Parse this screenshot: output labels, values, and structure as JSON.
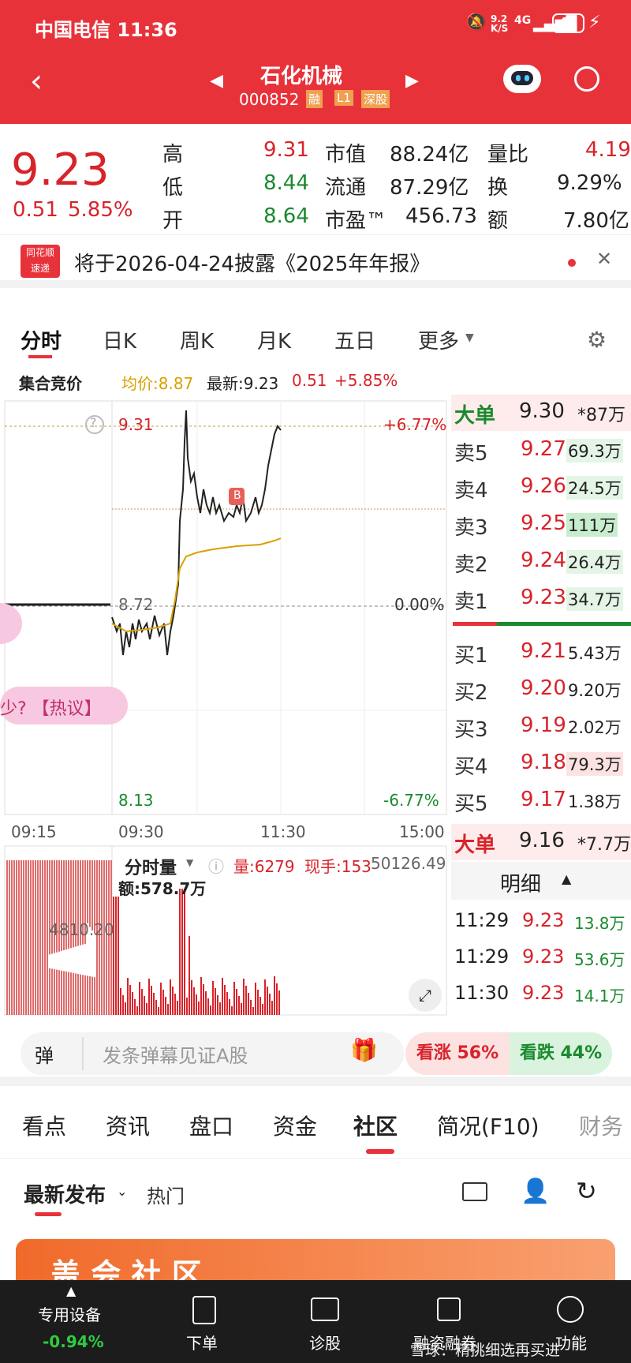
{
  "status": {
    "carrier_time": "中国电信 11:36",
    "net_speed": "9.2 K/S",
    "network": "4G",
    "battery": "43"
  },
  "header": {
    "title": "石化机械",
    "code": "000852",
    "badges": [
      "融",
      "L1",
      "深股"
    ]
  },
  "quote": {
    "price": "9.23",
    "change": "0.51",
    "change_pct": "5.85%",
    "stats": [
      {
        "label": "高",
        "value": "9.31"
      },
      {
        "label": "市值",
        "value": "88.24亿"
      },
      {
        "label": "量比",
        "value": "4.19"
      },
      {
        "label": "低",
        "value": "8.44"
      },
      {
        "label": "流通",
        "value": "87.29亿"
      },
      {
        "label": "换",
        "value": "9.29%"
      },
      {
        "label": "开",
        "value": "8.64"
      },
      {
        "label": "市盈™",
        "value": "456.73"
      },
      {
        "label": "额",
        "value": "7.80亿"
      }
    ]
  },
  "notice": {
    "logo_top": "同花顺",
    "logo_bottom": "速递",
    "text": "将于2026-04-24披露《2025年年报》"
  },
  "tabs": [
    "分时",
    "日K",
    "周K",
    "月K",
    "五日",
    "更多"
  ],
  "info_bar": {
    "label": "集合竞价",
    "avg": "均价:8.87",
    "latest": "最新:9.23",
    "chg": "0.51",
    "chg_pct": "+5.85%"
  },
  "chart": {
    "y_high": "9.31",
    "y_high_pct": "+6.77%",
    "y_mid": "8.72",
    "y_mid_pct": "0.00%",
    "y_low": "8.13",
    "y_low_pct": "-6.77%",
    "x_labels": [
      "09:15",
      "09:30",
      "11:30",
      "15:00"
    ],
    "marker": "B",
    "bubble_text": "少? 【热议】"
  },
  "volume": {
    "label": "分时量",
    "vol": "量:6279",
    "hand": "现手:153",
    "amount": "额:578.7万",
    "max": "50126.49",
    "mid": "4810.20"
  },
  "orderbook": {
    "big_top": {
      "label": "大单",
      "price": "9.30",
      "vol": "*87万"
    },
    "sell": [
      {
        "label": "卖5",
        "price": "9.27",
        "vol": "69.3万"
      },
      {
        "label": "卖4",
        "price": "9.26",
        "vol": "24.5万"
      },
      {
        "label": "卖3",
        "price": "9.25",
        "vol": "111万"
      },
      {
        "label": "卖2",
        "price": "9.24",
        "vol": "26.4万"
      },
      {
        "label": "卖1",
        "price": "9.23",
        "vol": "34.7万"
      }
    ],
    "buy": [
      {
        "label": "买1",
        "price": "9.21",
        "vol": "5.43万"
      },
      {
        "label": "买2",
        "price": "9.20",
        "vol": "9.20万"
      },
      {
        "label": "买3",
        "price": "9.19",
        "vol": "2.02万"
      },
      {
        "label": "买4",
        "price": "9.18",
        "vol": "79.3万"
      },
      {
        "label": "买5",
        "price": "9.17",
        "vol": "1.38万"
      }
    ],
    "big_bottom": {
      "label": "大单",
      "price": "9.16",
      "vol": "*7.7万"
    },
    "detail_title": "明细",
    "details": [
      {
        "time": "11:29",
        "price": "9.23",
        "vol": "13.8万"
      },
      {
        "time": "11:29",
        "price": "9.23",
        "vol": "53.6万"
      },
      {
        "time": "11:30",
        "price": "9.23",
        "vol": "14.1万"
      }
    ]
  },
  "danmu": {
    "icon_label": "弹",
    "placeholder": "发条弹幕见证A股",
    "up": "看涨 56%",
    "down": "看跌 44%"
  },
  "section_tabs": [
    "看点",
    "资讯",
    "盘口",
    "资金",
    "社区",
    "简况(F10)",
    "财务"
  ],
  "community": {
    "sort": "最新发布",
    "hot": "热门",
    "banner": "盖 会 社 区"
  },
  "bottombar": {
    "device": "专用设备",
    "device_pct": "-0.94%",
    "items": [
      "下单",
      "诊股",
      "融资融券",
      "功能"
    ],
    "watermark": "雪球：精挑细选再买进"
  }
}
